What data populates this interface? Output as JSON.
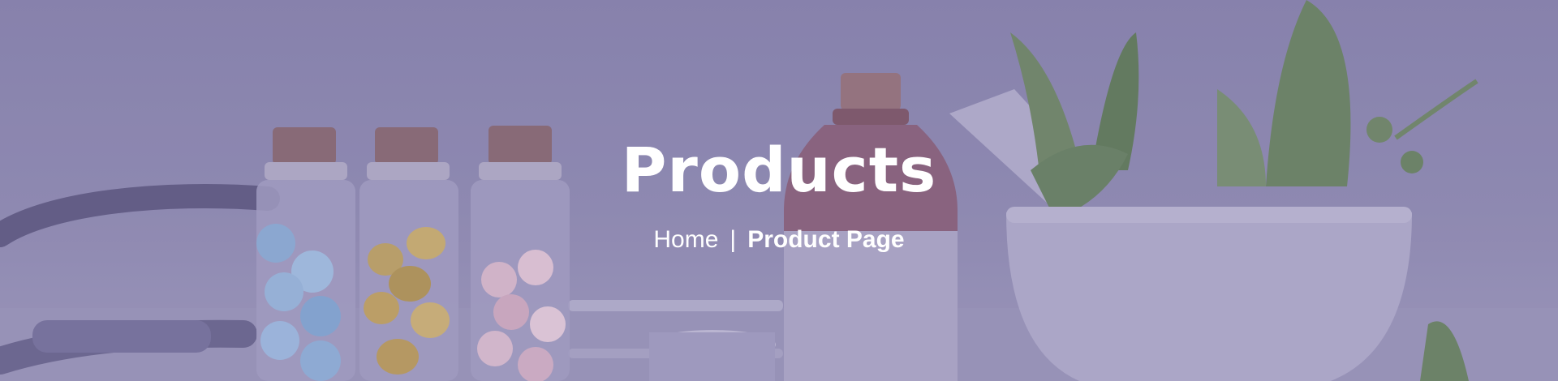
{
  "hero": {
    "title": "Products",
    "breadcrumb": {
      "home_label": "Home",
      "separator": "|",
      "current_label": "Product Page"
    },
    "overlay_color": "#8e8aad",
    "text_color": "#ffffff"
  },
  "background": {
    "description_icons": [
      "stethoscope-icon",
      "pill-jar-icon",
      "amber-bottle-icon",
      "mortar-herbs-icon"
    ]
  }
}
